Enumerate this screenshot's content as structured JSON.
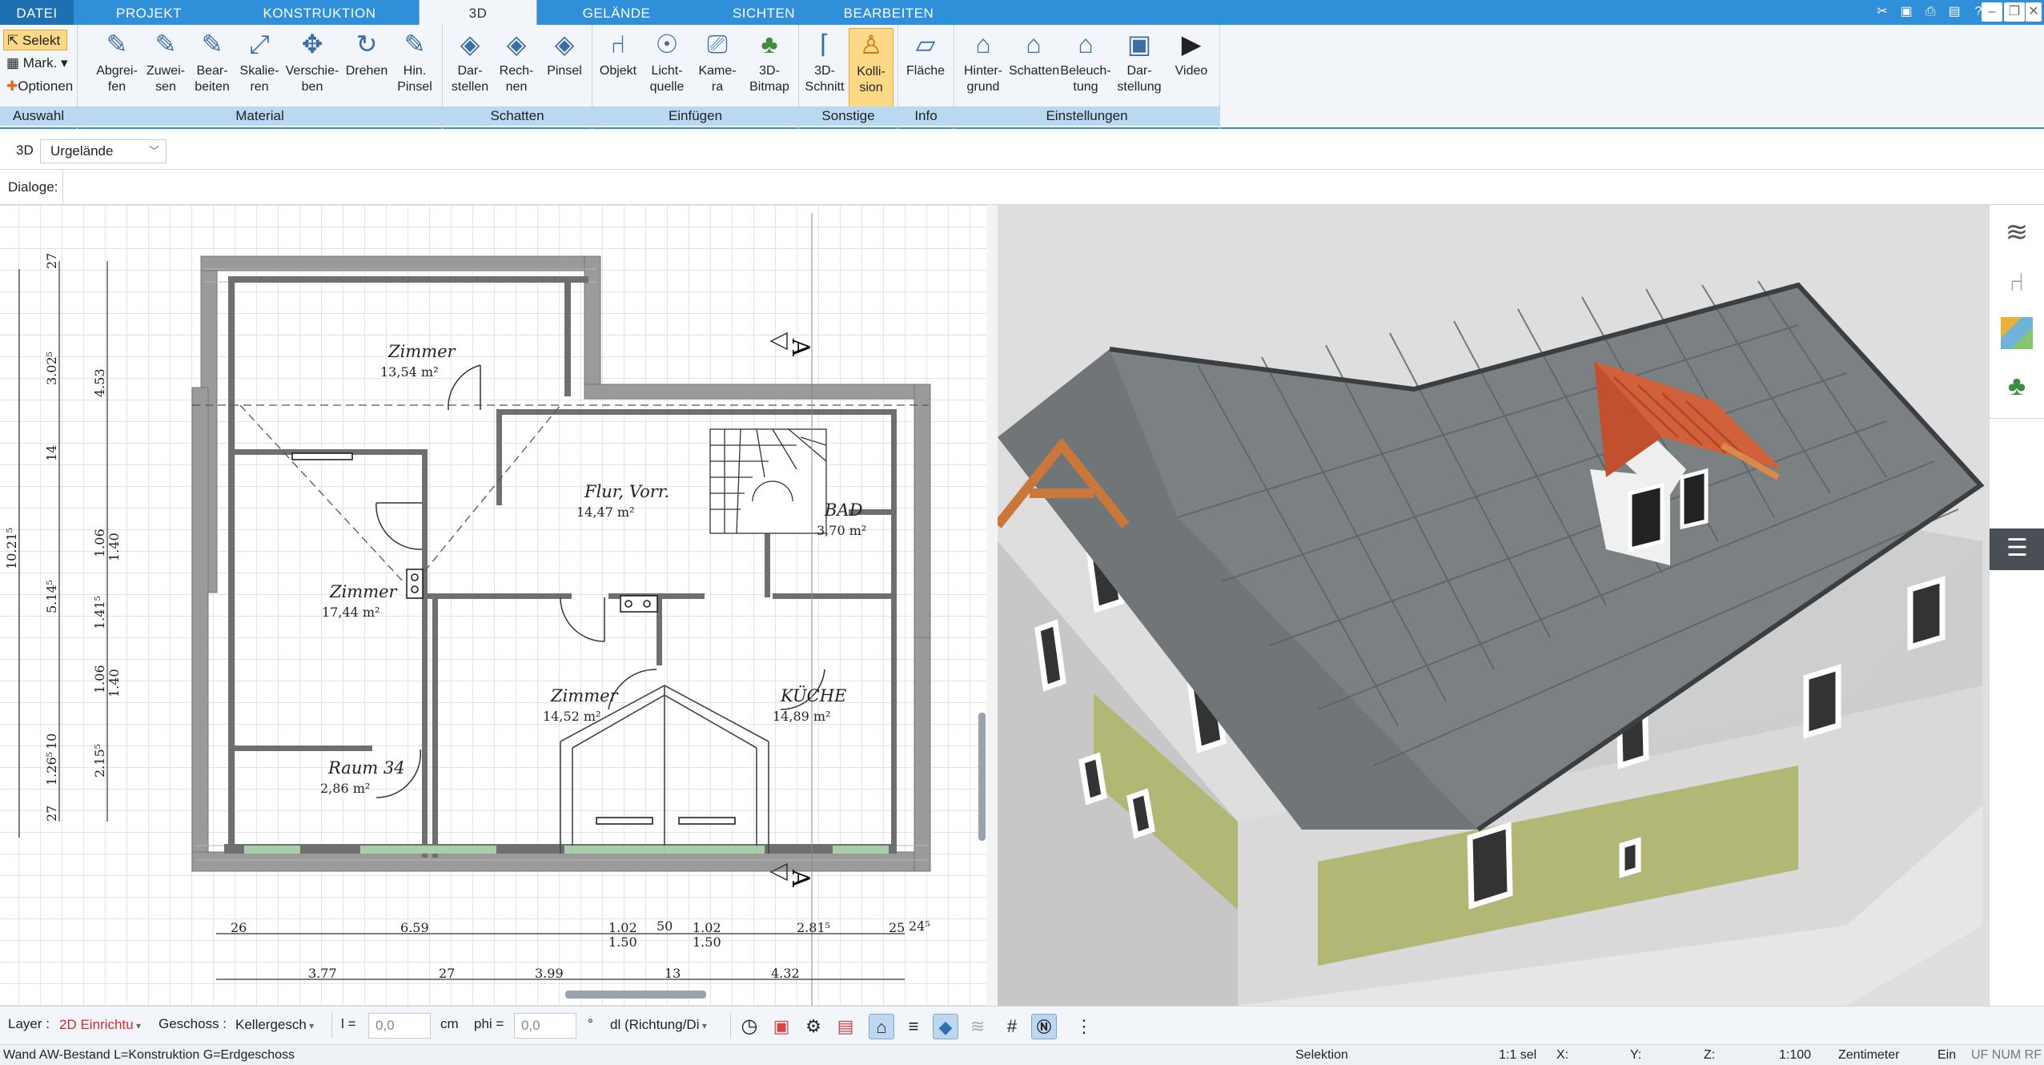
{
  "tabs": [
    "DATEI",
    "PROJEKT",
    "KONSTRUKTION",
    "3D",
    "GELÄNDE",
    "SICHTEN",
    "BEARBEITEN"
  ],
  "ribbon": {
    "auswahl": {
      "label": "Auswahl",
      "selekt": "Selekt",
      "mark": "Mark.",
      "optionen": "Optionen"
    },
    "material": {
      "label": "Material",
      "buttons": [
        "Abgrei-\nfen",
        "Zuwei-\nsen",
        "Bear-\nbeiten",
        "Skalie-\nren",
        "Verschie-\nben",
        "Drehen",
        "Hin.\nPinsel"
      ]
    },
    "schatten": {
      "label": "Schatten",
      "buttons": [
        "Dar-\nstellen",
        "Rech-\nnen",
        "Pinsel"
      ]
    },
    "einfuegen": {
      "label": "Einfügen",
      "buttons": [
        "Objekt",
        "Licht-\nquelle",
        "Kame-\nra",
        "3D-\nBitmap"
      ]
    },
    "sonstige": {
      "label": "Sonstige",
      "buttons": [
        "3D-\nSchnitt",
        "Kolli-\nsion"
      ]
    },
    "info": {
      "label": "Info",
      "buttons": [
        "Fläche"
      ]
    },
    "einstellungen": {
      "label": "Einstellungen",
      "buttons": [
        "Hinter-\ngrund",
        "Schatten",
        "Beleuch-\ntung",
        "Dar-\nstellung",
        "Video"
      ]
    }
  },
  "viewbar": {
    "mode": "3D",
    "selected": "Urgelände"
  },
  "dialogbar": {
    "label": "Dialoge:"
  },
  "plan": {
    "rooms": [
      {
        "name": "Zimmer",
        "area": "13,54 m²"
      },
      {
        "name": "Flur, Vorr.",
        "area": "14,47 m²"
      },
      {
        "name": "BAD",
        "area": "3,70 m²"
      },
      {
        "name": "Zimmer",
        "area": "17,44 m²"
      },
      {
        "name": "Zimmer",
        "area": "14,52 m²"
      },
      {
        "name": "KÜCHE",
        "area": "14,89 m²"
      },
      {
        "name": "Raum 34",
        "area": "2,86 m²"
      }
    ],
    "section_marker": "A",
    "dims_vertical_outer": [
      "10.21⁵"
    ],
    "dims_vertical_mid": [
      "27",
      "3.02⁵",
      "14",
      "5.14⁵",
      "10",
      "1.26⁵",
      "27"
    ],
    "dims_vertical_inner": [
      "4.53",
      "1.06",
      "1.40",
      "1.41⁵",
      "1.06",
      "1.40",
      "2.15⁵"
    ],
    "dims_horizontal_top": [
      "26",
      "6.59",
      "1.02",
      "1.50",
      "50",
      "1.02",
      "1.50",
      "2.81⁵",
      "25",
      "24⁵"
    ],
    "dims_horizontal_bottom": [
      "3.77",
      "27",
      "3.99",
      "13",
      "4.32"
    ]
  },
  "propbar": {
    "layer_label": "Layer :",
    "layer_value": "2D Einrichtu",
    "geschoss_label": "Geschoss :",
    "geschoss_value": "Kellergesch",
    "l_label": "l =",
    "l_value": "0,0",
    "l_unit": "cm",
    "phi_label": "phi =",
    "phi_value": "0,0",
    "phi_unit": "°",
    "dl_value": "dl (Richtung/Di"
  },
  "statusbar": {
    "left": "Wand AW-Bestand L=Konstruktion G=Erdgeschoss",
    "mode": "Selektion",
    "sel": "1:1 sel",
    "x": "X:",
    "y": "Y:",
    "z": "Z:",
    "scale": "1:100",
    "unit": "Zentimeter",
    "ein": "Ein",
    "flags": "UF NUM RF"
  },
  "colors": {
    "accent": "#2f8fd8",
    "ribbon_bg": "#f2f5f9",
    "group_label": "#b9d9f3",
    "active_button": "#fbd986",
    "wall": "#8f8f8f",
    "roof": "#6f7478",
    "dormer_roof": "#d2603a",
    "facade": "#bcc08a"
  }
}
